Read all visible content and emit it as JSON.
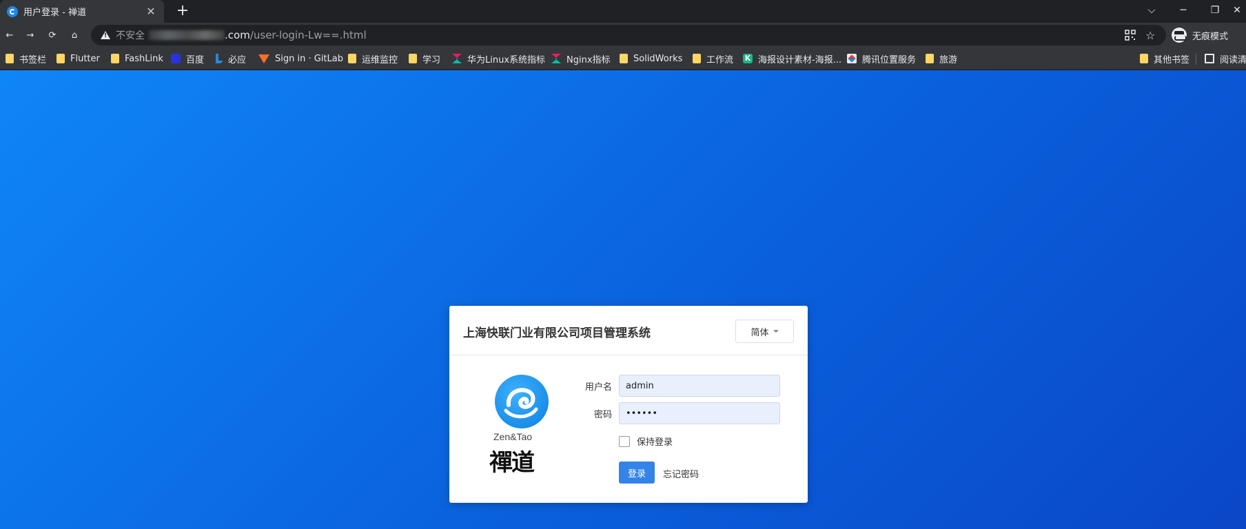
{
  "browser": {
    "tab": {
      "title": "用户登录 - 禅道",
      "close": "✕"
    },
    "new_tab": "+",
    "window_controls": {
      "dropdown": "⌵",
      "minimize": "─",
      "restore": "❐",
      "close": "✕"
    },
    "nav": {
      "back": "←",
      "forward": "→",
      "reload": "⟳",
      "home": "⌂"
    },
    "address": {
      "security_label": "不安全",
      "domain_visible": ".com",
      "path": "/user-login-Lw==.html"
    },
    "profile_label": "无痕模式",
    "bookmarks": [
      {
        "label": "书签栏",
        "icon": "folder-icon"
      },
      {
        "label": "Flutter",
        "icon": "folder-icon"
      },
      {
        "label": "FashLink",
        "icon": "folder-icon"
      },
      {
        "label": "百度",
        "icon": "baidu-icon"
      },
      {
        "label": "必应",
        "icon": "bing-icon"
      },
      {
        "label": "Sign in · GitLab",
        "icon": "gitlab-icon"
      },
      {
        "label": "运维监控",
        "icon": "folder-icon"
      },
      {
        "label": "学习",
        "icon": "folder-icon"
      },
      {
        "label": "华为Linux系统指标",
        "icon": "zabbix-icon"
      },
      {
        "label": "Nginx指标",
        "icon": "zabbix-icon"
      },
      {
        "label": "SolidWorks",
        "icon": "folder-icon"
      },
      {
        "label": "工作流",
        "icon": "folder-icon"
      },
      {
        "label": "海报设计素材-海报...",
        "icon": "k-icon"
      },
      {
        "label": "腾讯位置服务",
        "icon": "tencent-map-icon"
      },
      {
        "label": "旅游",
        "icon": "folder-icon"
      }
    ],
    "bookmarks_right": [
      {
        "label": "其他书签",
        "icon": "folder-icon"
      },
      {
        "label": "阅读清",
        "icon": "reading-list-icon"
      }
    ]
  },
  "login": {
    "title": "上海快联门业有限公司项目管理系统",
    "language": "简体",
    "logo_en": "Zen&Tao",
    "logo_cn": "禪道",
    "username_label": "用户名",
    "username_value": "admin",
    "password_label": "密码",
    "password_value": "••••••",
    "keep_login_label": "保持登录",
    "login_button": "登录",
    "forgot_password": "忘记密码"
  },
  "colors": {
    "page_gradient_start": "#0f86f6",
    "page_gradient_end": "#0a47c8",
    "primary_button": "#3483e8",
    "autofill_bg": "#e8f0fe"
  }
}
